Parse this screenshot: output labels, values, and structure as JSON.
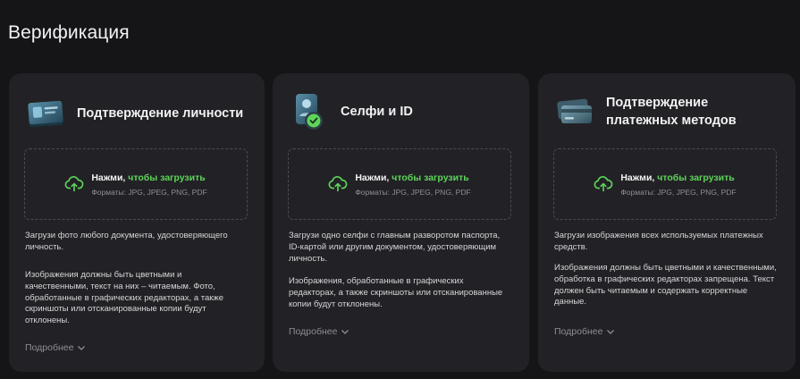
{
  "page": {
    "title": "Верификация"
  },
  "colors": {
    "accent": "#5ed45a",
    "card_bg": "#222226",
    "page_bg": "#151518",
    "muted": "#8d8d94"
  },
  "cards": [
    {
      "icon": "id-card-icon",
      "title": "Подтверждение личности",
      "upload": {
        "click": "Нажми,",
        "action": "чтобы загрузить",
        "formats": "Форматы: JPG, JPEG, PNG, PDF"
      },
      "desc1": "Загрузи фото любого документа, удостоверяющего личность.",
      "desc2": "Изображения должны быть цветными и качественными, текст на них – читаемым. Фото, обработанные в графических редакторах, а также скриншоты или отсканированные копии будут отклонены.",
      "more": "Подробнее"
    },
    {
      "icon": "selfie-id-icon",
      "title": "Селфи и ID",
      "upload": {
        "click": "Нажми,",
        "action": "чтобы загрузить",
        "formats": "Форматы: JPG, JPEG, PNG, PDF"
      },
      "desc1": "Загрузи одно селфи с главным разворотом паспорта, ID-картой или другим документом, удостоверяющим личность.",
      "desc2": "Изображения, обработанные в графических редакторах, а также скриншоты или отсканированные копии будут отклонены.",
      "more": "Подробнее"
    },
    {
      "icon": "payment-cards-icon",
      "title": "Подтверждение платежных методов",
      "upload": {
        "click": "Нажми,",
        "action": "чтобы загрузить",
        "formats": "Форматы: JPG, JPEG, PNG, PDF"
      },
      "desc1": "Загрузи изображения всех используемых платежных средств.",
      "desc2": "Изображения должны быть цветными и качественными, обработка в графических редакторах запрещена. Текст должен быть читаемым и содержать корректные данные.",
      "more": "Подробнее"
    }
  ]
}
